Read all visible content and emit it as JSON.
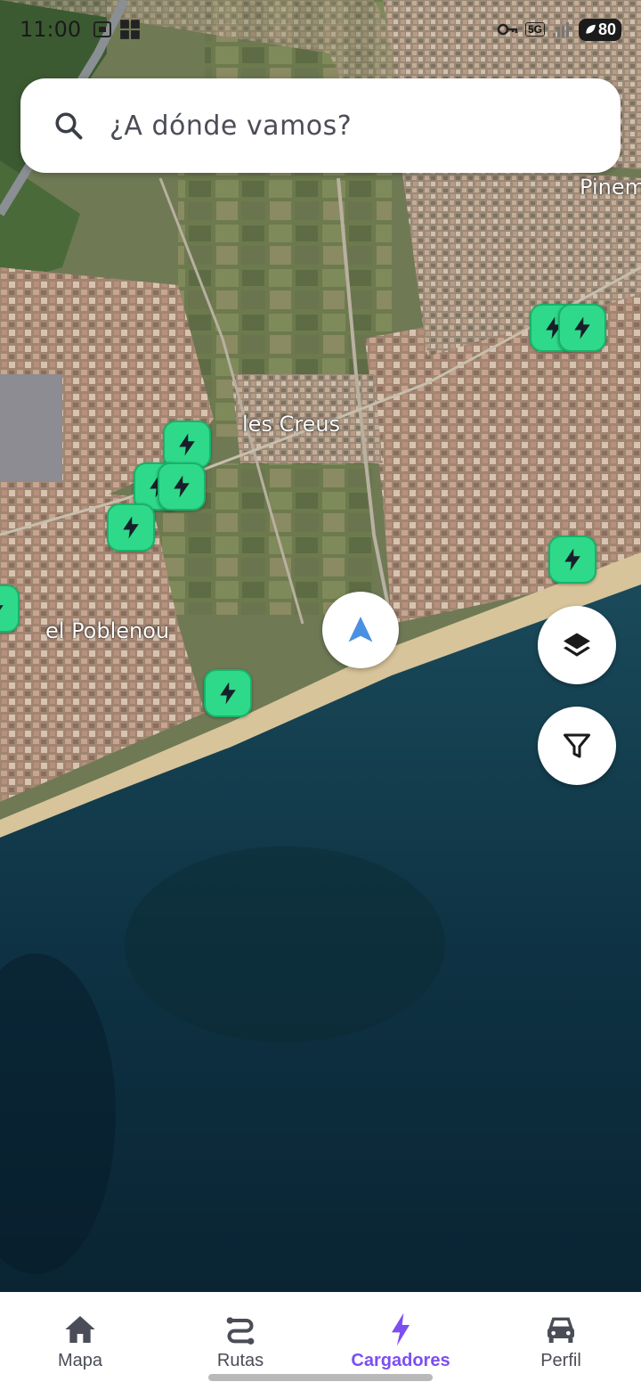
{
  "status_bar": {
    "time": "11:00",
    "battery": "80",
    "network": "5G"
  },
  "search": {
    "placeholder": "¿A dónde vamos?"
  },
  "map": {
    "labels": {
      "les_creus": "les Creus",
      "poblenou": "el Poblenou",
      "pineda": "Pinem"
    },
    "charger_color": "#2fd98a"
  },
  "controls": {
    "locate": "navigation-arrow-icon",
    "layers": "layers-icon",
    "filter": "filter-icon"
  },
  "nav": {
    "items": [
      {
        "label": "Mapa",
        "icon": "home-icon"
      },
      {
        "label": "Rutas",
        "icon": "route-icon"
      },
      {
        "label": "Cargadores",
        "icon": "bolt-icon"
      },
      {
        "label": "Perfil",
        "icon": "car-icon"
      }
    ],
    "active_index": 2,
    "active_color": "#7b4ff2"
  }
}
